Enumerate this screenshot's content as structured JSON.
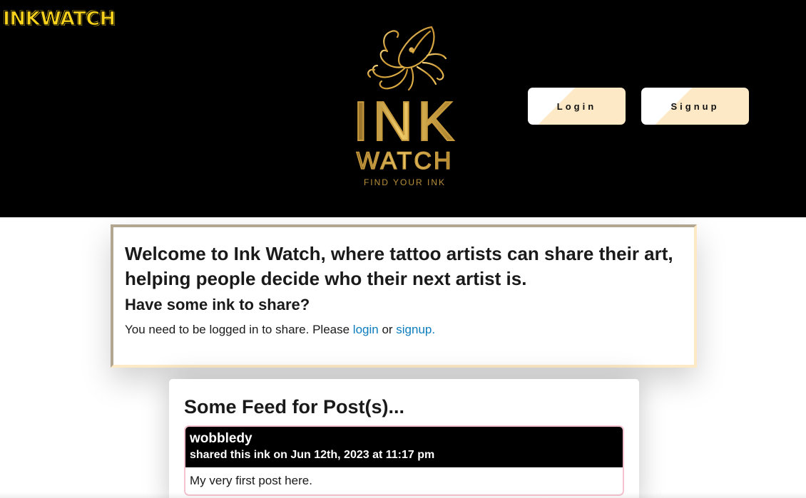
{
  "header": {
    "brand": "INKWATCH",
    "logo": {
      "line1": "INK",
      "line2": "WATCH",
      "tagline": "FIND YOUR INK",
      "icon": "squid-icon"
    },
    "login_label": "Login",
    "signup_label": "Signup"
  },
  "welcome": {
    "title": "Welcome to Ink Watch, where tattoo artists can share their art, helping people decide who their next artist is.",
    "subtitle": "Have some ink to share?",
    "text_before": "You need to be logged in to share. Please ",
    "login_link": "login",
    "text_middle": " or ",
    "signup_link": "signup."
  },
  "feed": {
    "title": "Some Feed for Post(s)...",
    "posts": [
      {
        "user": "wobbledy",
        "meta": "shared this ink on Jun 12th, 2023 at 11:17 pm",
        "body": "My very first post here."
      }
    ]
  },
  "colors": {
    "brand_yellow": "#f7d21c",
    "gold": "#d4a94a",
    "button_cream": "#fde9c6",
    "link_blue": "#0b7cbd"
  }
}
